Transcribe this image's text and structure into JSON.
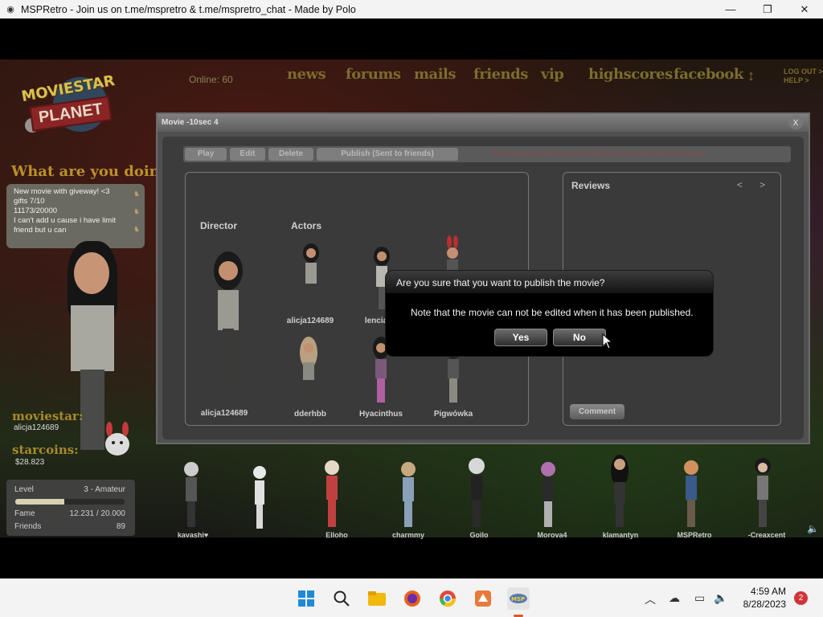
{
  "window": {
    "title": "MSPRetro - Join us on t.me/mspretro & t.me/mspretro_chat - Made by Polo",
    "minimize": "—",
    "maximize": "❐",
    "close": "✕"
  },
  "nav": {
    "online": "Online: 60",
    "items": [
      "news",
      "forums",
      "mails",
      "friends",
      "vip",
      "highscores",
      "facebook"
    ],
    "arrow": "↕",
    "logout": "LOG OUT >",
    "help": "HELP >"
  },
  "logo": {
    "line1": "MOVIESTAR",
    "line2": "PLANET"
  },
  "status": {
    "heading": "What are you doing?",
    "lines": [
      "New movie with  giveway! <3",
      "gifts 7/10",
      "11173/20000",
      "I can't add u cause i have limit",
      "friend but u can"
    ]
  },
  "profile": {
    "moviestar_label": "moviestar:",
    "username": "alicja124689",
    "starcoins_label": "starcoins:",
    "starcoins": "$28.823",
    "level_label": "Level",
    "level_value": "3 - Amateur",
    "level_progress": 0.45,
    "fame_label": "Fame",
    "fame_value": "12.231 / 20.000",
    "friends_label": "Friends",
    "friends_value": "89"
  },
  "movie": {
    "title": "Movie -10sec 4",
    "close": "x",
    "toolbar": {
      "play": "Play",
      "edit": "Edit",
      "delete": "Delete",
      "publish": "Publish (Sent to friends)",
      "message": "Your movie has been saved. Publish it to get views and be famous!"
    },
    "director_label": "Director",
    "actors_label": "Actors",
    "director": "alicja124689",
    "actors": [
      "alicja124689",
      "lencia",
      "dderhbb",
      "Hyacinthus",
      "Pigwówka"
    ],
    "reviews_label": "Reviews",
    "prev": "<",
    "next": ">",
    "comment": "Comment"
  },
  "confirm": {
    "question": "Are you sure that you want to publish the movie?",
    "note": "Note that the movie can not be edited when it has been published.",
    "yes": "Yes",
    "no": "No"
  },
  "crowd": [
    "kavashi♥",
    "Elloho",
    "charmmy",
    "Goilo",
    "Morova4",
    "klamantyn",
    "MSPRetro",
    "-Creaxcent"
  ],
  "taskbar": {
    "time": "4:59 AM",
    "date": "8/28/2023",
    "notifications": "2"
  },
  "colors": {
    "accent_gold": "#b9912a",
    "dialog_bg": "#000000",
    "taskbar_bg": "#f3f3f3"
  }
}
